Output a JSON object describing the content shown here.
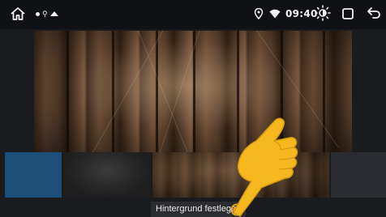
{
  "status_bar": {
    "time": "09:40",
    "icons": [
      "home-icon",
      "notification-dot-icon",
      "usb-icon",
      "warning-triangle-icon",
      "location-pin-icon",
      "wifi-icon",
      "brightness-icon",
      "recents-icon",
      "back-icon"
    ]
  },
  "wallpaper_picker": {
    "thumbnails": [
      "blue",
      "dark-gradient",
      "wood",
      "dark-gray"
    ],
    "set_wallpaper_label": "Hintergrund festlegen"
  },
  "colors": {
    "status_bar_bg": "#101114",
    "thumb_blue": "#1c4e78",
    "hand_pointer": "#f5b81f",
    "tooltip_bg": "#2c2d31"
  }
}
